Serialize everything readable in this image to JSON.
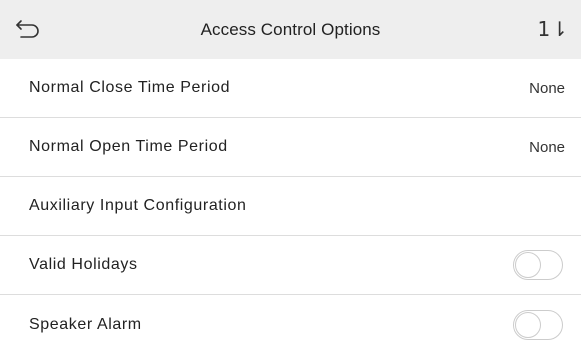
{
  "header": {
    "title": "Access Control Options",
    "back_icon": "back-arrow-icon",
    "sort_icon": "sort-icon",
    "sort_glyph": "1⇂"
  },
  "rows": [
    {
      "label": "Normal Close Time Period",
      "value": "None"
    },
    {
      "label": "Normal Open Time Period",
      "value": "None"
    },
    {
      "label": "Auxiliary Input Configuration"
    },
    {
      "label": "Valid Holidays",
      "toggle": false
    },
    {
      "label": "Speaker Alarm",
      "toggle": false
    }
  ],
  "colors": {
    "header_bg": "#eeeeee",
    "divider": "#dddddd",
    "toggle_border": "#cccccc"
  }
}
